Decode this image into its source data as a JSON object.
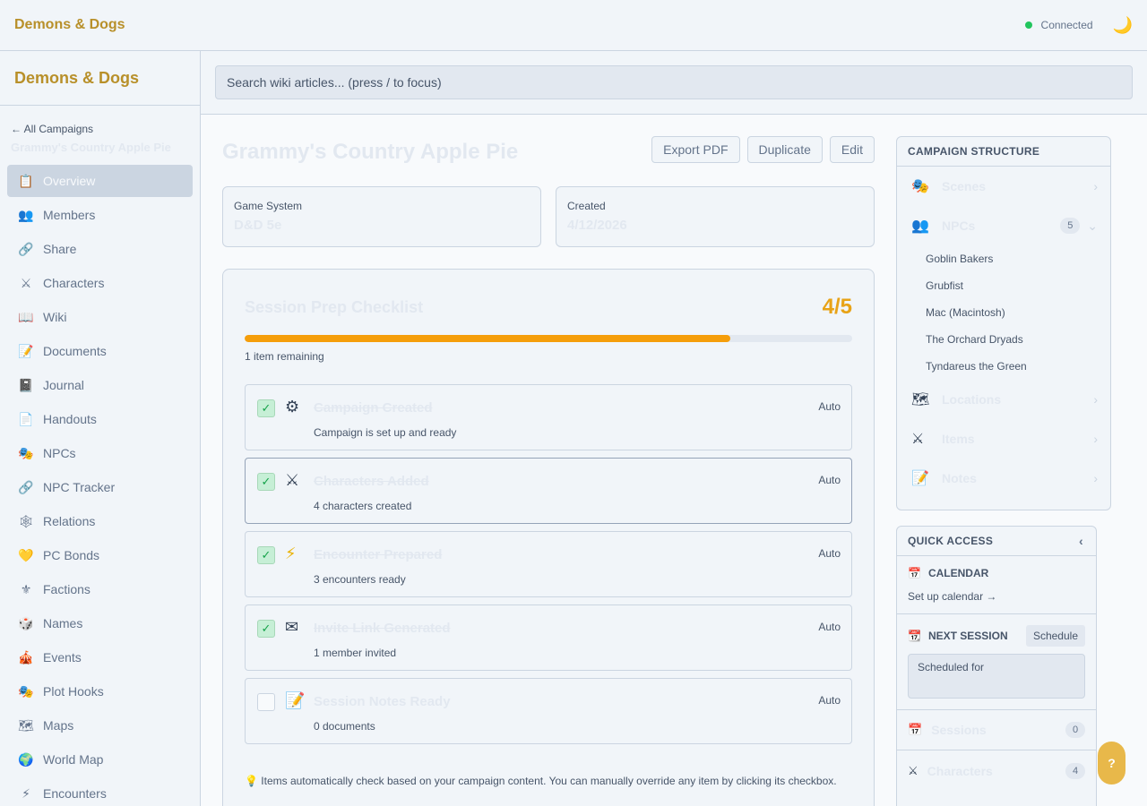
{
  "topbar": {
    "brand": "Demons & Dogs",
    "status": "Connected",
    "theme_icon": "moon-icon"
  },
  "sidebar": {
    "brand": "Demons & Dogs",
    "back": "← All Campaigns",
    "campaign": "Grammy's Country Apple Pie",
    "items": [
      {
        "label": "Overview",
        "icon": "📋"
      },
      {
        "label": "Members",
        "icon": "👥"
      },
      {
        "label": "Share",
        "icon": "🔗"
      },
      {
        "label": "Characters",
        "icon": "⚔"
      },
      {
        "label": "Wiki",
        "icon": "📖"
      },
      {
        "label": "Documents",
        "icon": "📝"
      },
      {
        "label": "Journal",
        "icon": "📓"
      },
      {
        "label": "Handouts",
        "icon": "📄"
      },
      {
        "label": "NPCs",
        "icon": "🎭"
      },
      {
        "label": "NPC Tracker",
        "icon": "🔗"
      },
      {
        "label": "Relations",
        "icon": "🕸"
      },
      {
        "label": "PC Bonds",
        "icon": "💛"
      },
      {
        "label": "Factions",
        "icon": "⚜"
      },
      {
        "label": "Names",
        "icon": "🎲"
      },
      {
        "label": "Events",
        "icon": "🎪"
      },
      {
        "label": "Plot Hooks",
        "icon": "🎭"
      },
      {
        "label": "Maps",
        "icon": "🗺"
      },
      {
        "label": "World Map",
        "icon": "🌍"
      },
      {
        "label": "Encounters",
        "icon": "⚡"
      }
    ]
  },
  "search": {
    "placeholder": "Search wiki articles... (press / to focus)"
  },
  "main": {
    "title": "Grammy's Country Apple Pie",
    "actions": {
      "export": "Export PDF",
      "duplicate": "Duplicate",
      "edit": "Edit"
    },
    "game_system": {
      "label": "Game System",
      "value": "D&D 5e"
    },
    "created": {
      "label": "Created",
      "value": "4/12/2026"
    }
  },
  "checklist": {
    "title": "Session Prep Checklist",
    "count": "4/5",
    "progress": 0.8,
    "remaining": "1 item remaining",
    "tasks": [
      {
        "name": "Campaign Created",
        "sub": "Campaign is set up and ready",
        "auto": "Auto",
        "done": true,
        "icon": "⚙"
      },
      {
        "name": "Characters Added",
        "sub": "4 characters created",
        "auto": "Auto",
        "done": true,
        "icon": "⚔"
      },
      {
        "name": "Encounter Prepared",
        "sub": "3 encounters ready",
        "auto": "Auto",
        "done": true,
        "icon": "⚡"
      },
      {
        "name": "Invite Link Generated",
        "sub": "1 member invited",
        "auto": "Auto",
        "done": true,
        "icon": "✉"
      },
      {
        "name": "Session Notes Ready",
        "sub": "0 documents",
        "auto": "Auto",
        "done": false,
        "icon": "📝"
      }
    ],
    "footnote": "💡 Items automatically check based on your campaign content. You can manually override any item by clicking its checkbox."
  },
  "structure": {
    "title": "CAMPAIGN STRUCTURE",
    "scenes": "Scenes",
    "npcs": "NPCs",
    "npc_count": "5",
    "npc_list": [
      "Goblin Bakers",
      "Grubfist",
      "Mac (Macintosh)",
      "The Orchard Dryads",
      "Tyndareus the Green"
    ],
    "locations": "Locations",
    "items": "Items",
    "notes": "Notes"
  },
  "quick": {
    "title": "QUICK ACCESS",
    "calendar": "CALENDAR",
    "calendar_link": "Set up calendar →",
    "next_session": "NEXT SESSION",
    "schedule": "Schedule",
    "scheduled_for": "Scheduled for",
    "sessions": "Sessions",
    "sessions_count": "0",
    "characters": "Characters",
    "characters_count": "4"
  },
  "help": "?"
}
